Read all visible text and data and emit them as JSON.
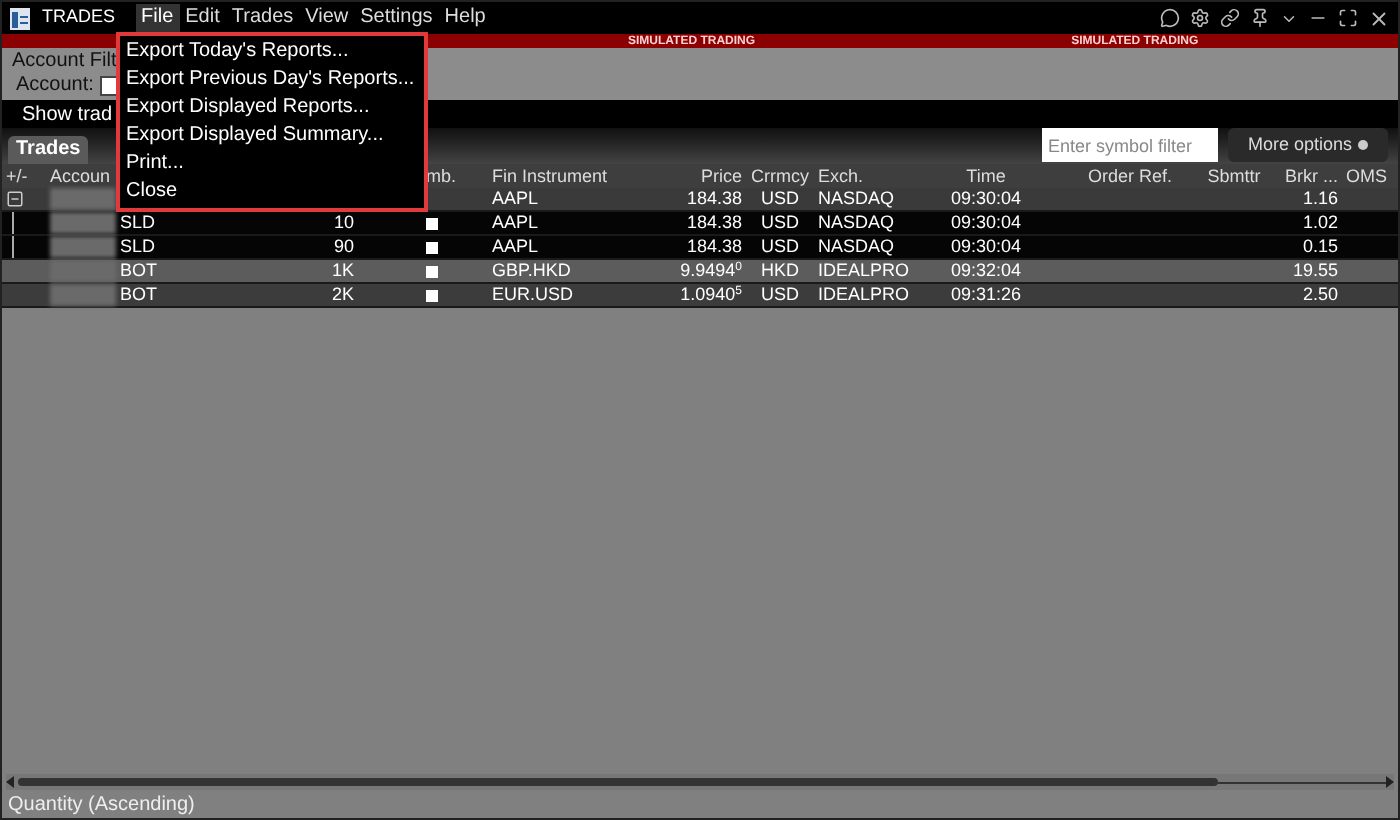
{
  "window": {
    "title": "TRADES"
  },
  "menu_bar": [
    {
      "label": "File",
      "selected": true
    },
    {
      "label": "Edit",
      "selected": false
    },
    {
      "label": "Trades",
      "selected": false
    },
    {
      "label": "View",
      "selected": false
    },
    {
      "label": "Settings",
      "selected": false
    },
    {
      "label": "Help",
      "selected": false
    }
  ],
  "banner": [
    "SIMULATED TRADING",
    "SIMULATED TRADING"
  ],
  "file_menu": [
    "Export Today's Reports...",
    "Export Previous Day's Reports...",
    "Export Displayed Reports...",
    "Export Displayed Summary...",
    "Print...",
    "Close"
  ],
  "filter_panel": {
    "title": "Account Filt",
    "account_label": "Account:"
  },
  "show_trades": "Show trad",
  "tab": {
    "label": "Trades",
    "selected": true
  },
  "symbol_filter": {
    "placeholder": "Enter symbol filter"
  },
  "more_options": "More options",
  "table": {
    "columns": {
      "pm": "+/-",
      "account": "Accoun",
      "cmb": "mb.",
      "fin": "Fin Instrument",
      "price": "Price",
      "crrmcy": "Crrmcy",
      "exch": "Exch.",
      "time": "Time",
      "orderref": "Order Ref.",
      "sbmttr": "Sbmttr",
      "brkr": "Brkr ...",
      "oms": "OMS"
    },
    "rows": [
      {
        "fin": "AAPL",
        "price": "184.38",
        "crrmcy": "USD",
        "exch": "NASDAQ",
        "time": "09:30:04",
        "brkr": "1.16",
        "combo_box": false,
        "expanded": true,
        "children": [
          {
            "action": "SLD",
            "quantity": "10",
            "fin": "AAPL",
            "price": "184.38",
            "crrmcy": "USD",
            "exch": "NASDAQ",
            "time": "09:30:04",
            "brkr": "1.02",
            "combo_box": true
          },
          {
            "action": "SLD",
            "quantity": "90",
            "fin": "AAPL",
            "price": "184.38",
            "crrmcy": "USD",
            "exch": "NASDAQ",
            "time": "09:30:04",
            "brkr": "0.15",
            "combo_box": true
          }
        ]
      },
      {
        "action": "BOT",
        "quantity": "1K",
        "fin": "GBP.HKD",
        "price": "9.9494$^{0}$",
        "crrmcy": "HKD",
        "exch": "IDEALPRO",
        "time": "09:32:04",
        "brkr": "19.55",
        "combo_box": true
      },
      {
        "action": "BOT",
        "quantity": "2K",
        "fin": "EUR.USD",
        "price": "1.0940$^{5}$",
        "crrmcy": "USD",
        "exch": "IDEALPRO",
        "time": "09:31:26",
        "brkr": "2.50",
        "combo_box": true
      }
    ]
  },
  "status_bar": "Quantity (Ascending)"
}
